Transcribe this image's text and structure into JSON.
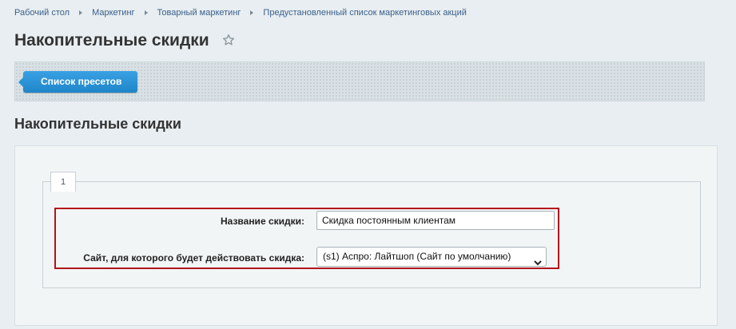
{
  "breadcrumb": [
    "Рабочий стол",
    "Маркетинг",
    "Товарный маркетинг",
    "Предустановленный список маркетинговых акций"
  ],
  "page_title": "Накопительные скидки",
  "toolbar": {
    "presets_button": "Список пресетов"
  },
  "section_title": "Накопительные скидки",
  "form": {
    "tab_label": "1",
    "name_label": "Название скидки:",
    "name_value": "Скидка постоянным клиентам",
    "site_label": "Сайт, для которого будет действовать скидка:",
    "site_value": "(s1) Аспро: Лайтшоп (Сайт по умолчанию)"
  },
  "colors": {
    "accent": "#1f85c9",
    "highlight_border": "#b2141b"
  },
  "icons": {
    "favorite": "star-icon",
    "select": "chevron-down-icon"
  }
}
